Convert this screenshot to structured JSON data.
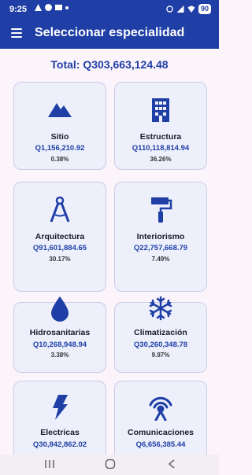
{
  "status": {
    "time": "9:25",
    "battery": "90"
  },
  "appbar": {
    "title": "Seleccionar especialidad"
  },
  "total": "Total: Q303,663,124.48",
  "cards": [
    {
      "name": "Sitio",
      "amount": "Q1,156,210.92",
      "pct": "0.38%",
      "icon": "mountain-icon"
    },
    {
      "name": "Estructura",
      "amount": "Q110,118,814.94",
      "pct": "36.26%",
      "icon": "building-icon"
    },
    {
      "name": "Arquitectura",
      "amount": "Q91,601,884.65",
      "pct": "30.17%",
      "icon": "compass-icon"
    },
    {
      "name": "Interiorismo",
      "amount": "Q22,757,668.79",
      "pct": "7.49%",
      "icon": "paint-roller-icon"
    },
    {
      "name": "Hidrosanitarias",
      "amount": "Q10,268,948.94",
      "pct": "3.38%",
      "icon": "water-drop-icon"
    },
    {
      "name": "Climatización",
      "amount": "Q30,260,348.78",
      "pct": "9.97%",
      "icon": "snowflake-icon"
    },
    {
      "name": "Electricas",
      "amount": "Q30,842,862.02",
      "pct": "",
      "icon": "lightning-icon"
    },
    {
      "name": "Comunicaciones",
      "amount": "Q6,656,385.44",
      "pct": "",
      "icon": "antenna-icon"
    }
  ],
  "colors": {
    "primary": "#1f3fa6",
    "card_bg": "#edf0fb",
    "page_bg": "#fcf4fb"
  }
}
